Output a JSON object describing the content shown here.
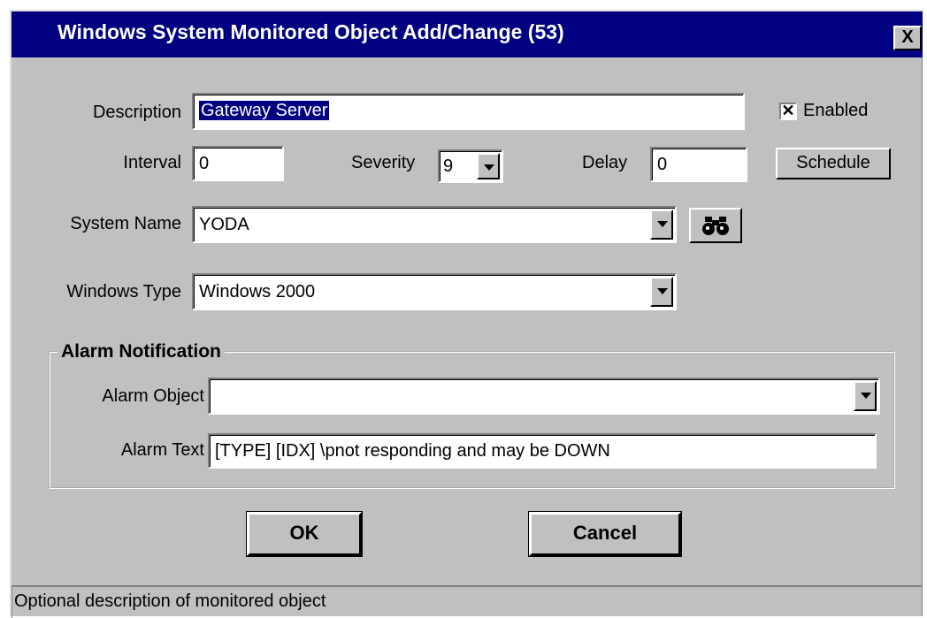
{
  "window": {
    "title": "Windows System Monitored Object Add/Change (53)",
    "close_label": "X"
  },
  "form": {
    "description_label": "Description",
    "description_value": "Gateway Server",
    "enabled_label": "Enabled",
    "enabled_checked": true,
    "interval_label": "Interval",
    "interval_value": "0",
    "severity_label": "Severity",
    "severity_value": "9",
    "delay_label": "Delay",
    "delay_value": "0",
    "schedule_label": "Schedule",
    "system_name_label": "System Name",
    "system_name_value": "YODA",
    "find_icon": "binoculars-icon",
    "windows_type_label": "Windows Type",
    "windows_type_value": "Windows 2000"
  },
  "alarm": {
    "group_label": "Alarm Notification",
    "object_label": "Alarm Object",
    "object_value": "",
    "text_label": "Alarm Text",
    "text_value": "[TYPE] [IDX] \\pnot responding and may be DOWN"
  },
  "buttons": {
    "ok_label": "OK",
    "cancel_label": "Cancel"
  },
  "status_bar": {
    "text": "Optional description of monitored object"
  },
  "colors": {
    "title_bar": "#000080",
    "face": "#c0c0c0",
    "selection": "#000080"
  }
}
